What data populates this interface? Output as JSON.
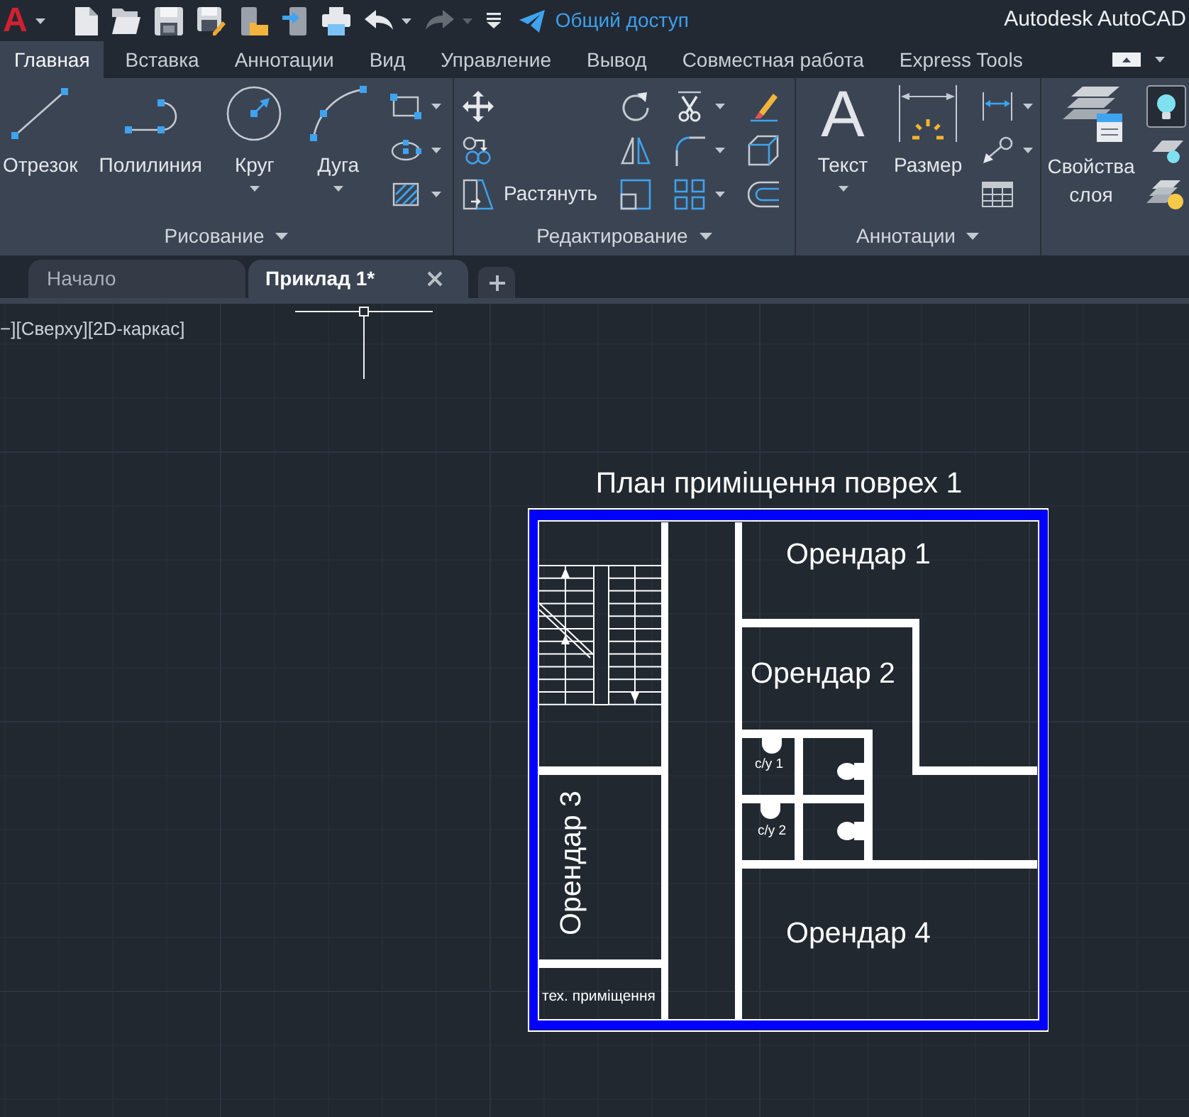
{
  "title_bar": {
    "logo": "A",
    "quick_access": [
      {
        "kind": "new",
        "disabled": false,
        "dropdown": false
      },
      {
        "kind": "open",
        "disabled": false,
        "dropdown": false
      },
      {
        "kind": "save",
        "disabled": false,
        "dropdown": false
      },
      {
        "kind": "save_as",
        "disabled": false,
        "dropdown": false
      },
      {
        "kind": "open_web",
        "disabled": false,
        "dropdown": false
      },
      {
        "kind": "share_mobile",
        "disabled": false,
        "dropdown": false
      },
      {
        "kind": "print",
        "disabled": false,
        "dropdown": false
      },
      {
        "kind": "undo",
        "disabled": false,
        "dropdown": true
      },
      {
        "kind": "redo",
        "disabled": true,
        "dropdown": true
      },
      {
        "kind": "customize",
        "disabled": false,
        "dropdown": false
      }
    ],
    "share": "Общий доступ",
    "app_title": "Autodesk AutoCAD"
  },
  "ribbon_tabs": [
    {
      "label": "Главная",
      "selected": true
    },
    {
      "label": "Вставка",
      "selected": false
    },
    {
      "label": "Аннотации",
      "selected": false
    },
    {
      "label": "Вид",
      "selected": false
    },
    {
      "label": "Управление",
      "selected": false
    },
    {
      "label": "Вывод",
      "selected": false
    },
    {
      "label": "Совместная работа",
      "selected": false
    },
    {
      "label": "Express Tools",
      "selected": false
    }
  ],
  "ribbon_panels": [
    {
      "title": "Рисование",
      "large_tools": [
        {
          "kind": "line",
          "label": "Отрезок",
          "dropdown": false
        },
        {
          "kind": "polyline",
          "label": "Полилиния",
          "dropdown": false
        },
        {
          "kind": "circle",
          "label": "Круг",
          "dropdown": true
        },
        {
          "kind": "arc",
          "label": "Дуга",
          "dropdown": true
        }
      ],
      "small_tools": [
        {
          "kind": "rectangle",
          "dropdown": true
        },
        {
          "kind": "ellipse",
          "dropdown": true
        },
        {
          "kind": "hatch",
          "dropdown": true
        }
      ]
    },
    {
      "title": "Редактирование",
      "small_tools": [
        {
          "kind": "move",
          "dropdown": false
        },
        {
          "kind": "copy",
          "dropdown": false
        },
        {
          "kind": "stretch",
          "label": "Растянуть",
          "dropdown": false
        },
        {
          "kind": "rotate",
          "dropdown": false
        },
        {
          "kind": "mirror",
          "dropdown": false
        },
        {
          "kind": "scale",
          "dropdown": false
        },
        {
          "kind": "trim",
          "dropdown": true
        },
        {
          "kind": "fillet",
          "dropdown": true
        },
        {
          "kind": "array",
          "dropdown": true
        },
        {
          "kind": "erase",
          "dropdown": false
        },
        {
          "kind": "solid",
          "dropdown": false
        },
        {
          "kind": "offset",
          "dropdown": false
        }
      ]
    },
    {
      "title": "Аннотации",
      "large_tools": [
        {
          "kind": "text",
          "glyph": "A",
          "label": "Текст",
          "dropdown": true
        },
        {
          "kind": "dimension",
          "label": "Размер",
          "dropdown": false
        }
      ],
      "small_tools": [
        {
          "kind": "linear_dimension",
          "dropdown": true
        },
        {
          "kind": "leader",
          "dropdown": true
        },
        {
          "kind": "table",
          "dropdown": false
        }
      ]
    },
    {
      "large_tools": [
        {
          "kind": "layer_properties",
          "label": "Свойства слоя",
          "dropdown": false
        }
      ],
      "small_tools": [
        {
          "kind": "layer_bulb",
          "active": true,
          "dropdown": false
        },
        {
          "kind": "layer_single",
          "active": false,
          "dropdown": false
        },
        {
          "kind": "layer_stack_bulb",
          "active": false,
          "dropdown": false
        }
      ]
    }
  ],
  "file_tabs": [
    {
      "label": "Начало",
      "selected": false,
      "closable": false
    },
    {
      "label": "Приклад 1*",
      "selected": true,
      "closable": true
    }
  ],
  "viewport_label": "−][Сверху][2D-каркас]",
  "drawing": {
    "title": "План приміщення поврех 1",
    "rooms": [
      {
        "label": "Орендар 1"
      },
      {
        "label": "Орендар 2"
      },
      {
        "label": "Орендар 3"
      },
      {
        "label": "Орендар 4"
      },
      {
        "label": "с/у 1"
      },
      {
        "label": "с/у 2"
      },
      {
        "label": "тех. приміщення"
      }
    ]
  }
}
